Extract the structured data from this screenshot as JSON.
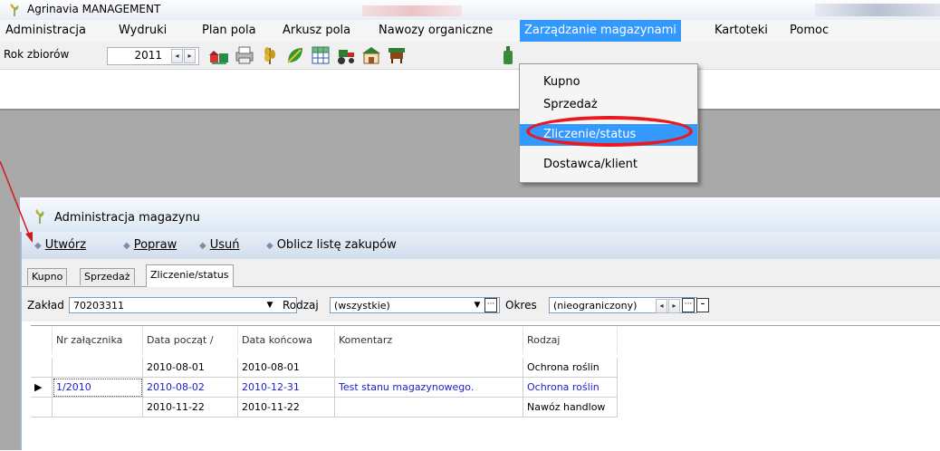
{
  "app": {
    "title": "Agrinavia MANAGEMENT"
  },
  "menubar": {
    "items": [
      "Administracja",
      "Wydruki",
      "Plan pola",
      "Arkusz pola",
      "Nawozy organiczne",
      "Zarządzanie magazynami",
      "Kartoteki",
      "Pomoc"
    ],
    "active": "Zarządzanie magazynami"
  },
  "toolbar": {
    "year_label": "Rok zbiorów",
    "year_value": "2011"
  },
  "dropdown": {
    "items": [
      "Kupno",
      "Sprzedaż",
      "Zliczenie/status",
      "Dostawca/klient"
    ],
    "selected": "Zliczenie/status",
    "highlight_color": "#e8191f"
  },
  "window": {
    "title": "Administracja magazynu",
    "actions": [
      "Utwórz",
      "Popraw",
      "Usuń",
      "Oblicz listę zakupów"
    ],
    "tabs": [
      "Kupno",
      "Sprzedaż",
      "Zliczenie/status"
    ],
    "active_tab": "Zliczenie/status",
    "filters": {
      "zaklad_label": "Zakład",
      "zaklad_value": "70203311",
      "rodzaj_label": "Rodzaj",
      "rodzaj_value": "(wszystkie)",
      "okres_label": "Okres",
      "okres_value": "(nieograniczony)"
    },
    "grid": {
      "columns": [
        "Nr załącznika",
        "Data począt /",
        "Data końcowa",
        "Komentarz",
        "Rodzaj"
      ],
      "rows": [
        [
          "",
          "2010-08-01",
          "2010-08-01",
          "",
          "Ochrona roślin"
        ],
        [
          "1/2010",
          "2010-08-02",
          "2010-12-31",
          "Test stanu magazynowego.",
          "Ochrona roślin"
        ],
        [
          "",
          "2010-11-22",
          "2010-11-22",
          "",
          "Nawóz handlow"
        ]
      ],
      "current_row": 1
    }
  },
  "colors": {
    "menu_highlight": "#3399ff",
    "row_selected_text": "#1b1bd4",
    "annotation_red": "#e8191f"
  }
}
